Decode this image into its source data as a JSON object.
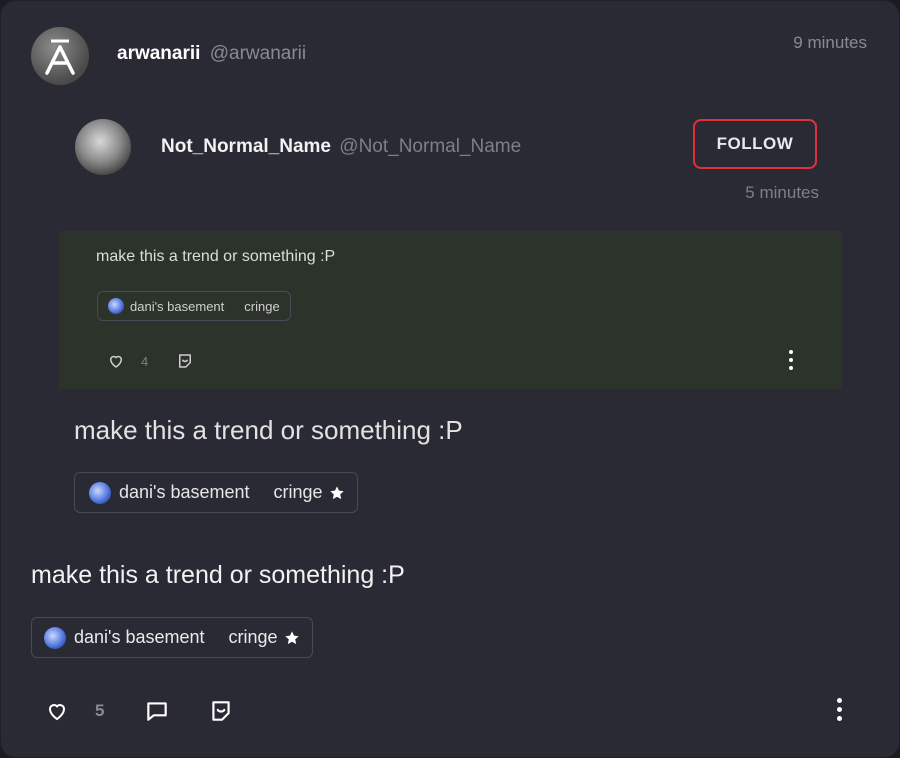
{
  "post": {
    "author_name": "arwanarii",
    "author_handle": "@arwanarii",
    "timestamp": "9 minutes",
    "text": "make this a trend or something :P",
    "tags": {
      "community": "dani's basement",
      "tag": "cringe"
    },
    "like_count": "5"
  },
  "quote_mid": {
    "text": "make this a trend or something :P",
    "tags": {
      "community": "dani's basement",
      "tag": "cringe"
    }
  },
  "quoted": {
    "author_name": "Not_Normal_Name",
    "author_handle": "@Not_Normal_Name",
    "follow_label": "FOLLOW",
    "timestamp": "5 minutes",
    "text": "make this a trend or something :P",
    "tags": {
      "community": "dani's basement",
      "tag": "cringe"
    },
    "like_count": "4"
  },
  "colors": {
    "card_bg": "#2a2a34",
    "follow_border": "#e0313b",
    "quote_bg": "#2c332b"
  }
}
